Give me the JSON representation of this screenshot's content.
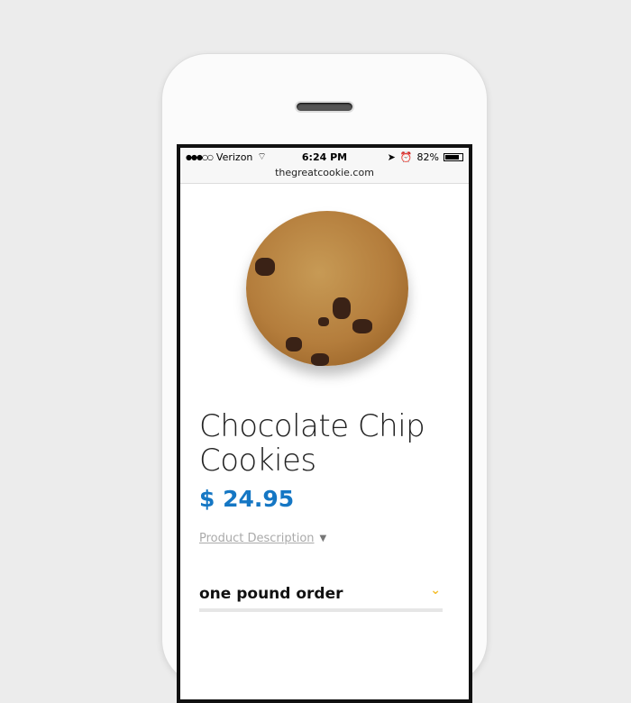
{
  "status_bar": {
    "signal": "●●●○○",
    "carrier": "Verizon",
    "time": "6:24 PM",
    "battery": "82%",
    "battery_level": 0.82
  },
  "browser": {
    "url": "thegreatcookie.com"
  },
  "product": {
    "title_line1": "Chocolate Chip",
    "title_line2": "Cookies",
    "price": "$ 24.95",
    "description_link": "Product Description",
    "option": "one pound order"
  },
  "colors": {
    "price": "#1577c4",
    "option_chevron": "#f5c033"
  }
}
